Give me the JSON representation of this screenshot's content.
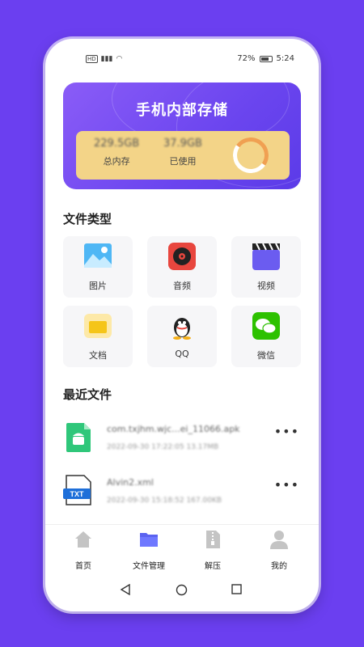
{
  "status_bar": {
    "left_icons": [
      "HD",
      "sim"
    ],
    "battery": "72%",
    "time": "5:24"
  },
  "storage": {
    "title": "手机内部存储",
    "total_value": "229.5GB",
    "total_label": "总内存",
    "used_value": "37.9GB",
    "used_label": "已使用",
    "used_fraction": 0.165
  },
  "file_types": {
    "title": "文件类型",
    "items": [
      {
        "label": "图片",
        "icon": "image-icon"
      },
      {
        "label": "音频",
        "icon": "music-icon"
      },
      {
        "label": "视频",
        "icon": "video-icon"
      },
      {
        "label": "文档",
        "icon": "folder-icon"
      },
      {
        "label": "QQ",
        "icon": "qq-icon"
      },
      {
        "label": "微信",
        "icon": "wechat-icon"
      }
    ]
  },
  "recent_files": {
    "title": "最近文件",
    "items": [
      {
        "name": "com.txjhm.wjc...ei_11066.apk",
        "meta": "2022-09-30 17:22:05   13.17MB",
        "icon": "apk-icon"
      },
      {
        "name": "Alvin2.xml",
        "meta": "2022-09-30 15:18:52   167.00KB",
        "icon": "txt-icon",
        "icon_text": "TXT"
      }
    ]
  },
  "tabbar": {
    "items": [
      {
        "label": "首页",
        "icon": "home-icon"
      },
      {
        "label": "文件管理",
        "icon": "folder-icon"
      },
      {
        "label": "解压",
        "icon": "zip-icon"
      },
      {
        "label": "我的",
        "icon": "user-icon"
      }
    ]
  },
  "colors": {
    "background": "#6b3ff0",
    "card_gradient_start": "#8a5cf7",
    "card_inner": "#f3d488",
    "ring_accent": "#f0a052",
    "active_tab": "#5b63f0"
  }
}
